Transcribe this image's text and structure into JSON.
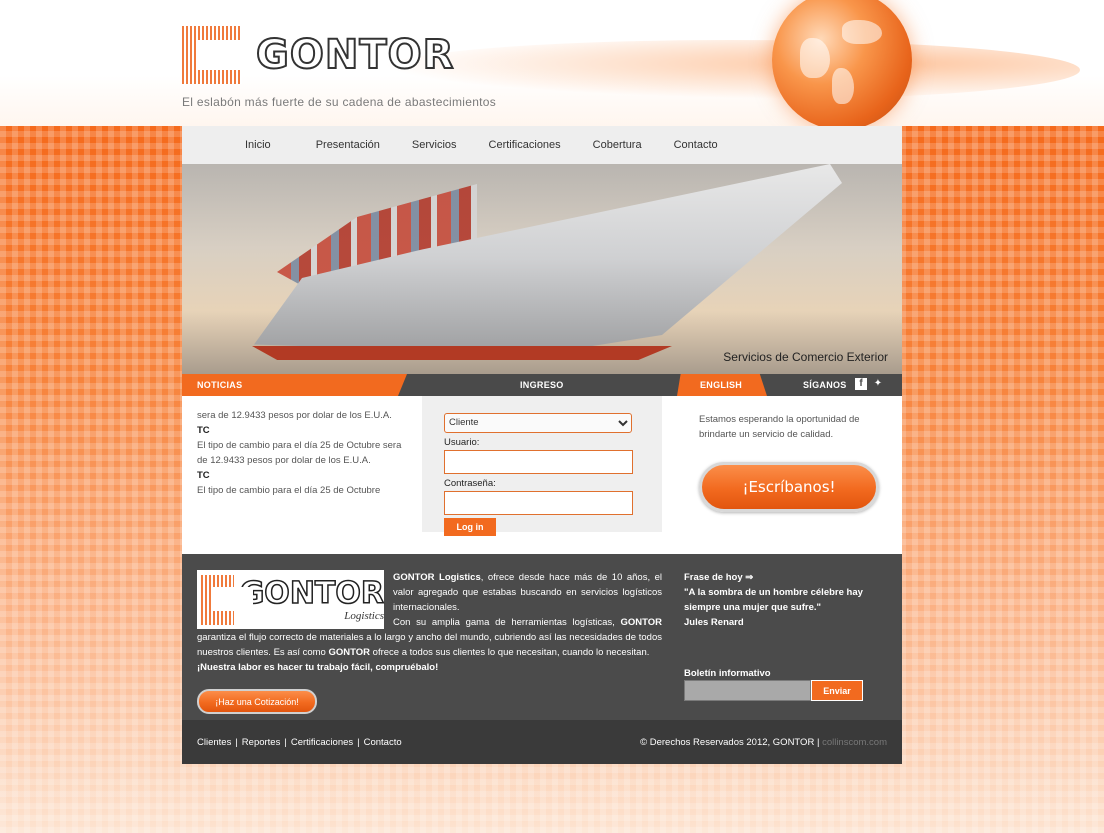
{
  "brand": {
    "name": "GONTOR",
    "tagline": "El eslabón más fuerte de su cadena de abastecimientos"
  },
  "nav": [
    "Inicio",
    "Presentación",
    "Servicios",
    "Certificaciones",
    "Cobertura",
    "Contacto"
  ],
  "hero": {
    "caption": "Servicios de Comercio Exterior"
  },
  "bar": {
    "news": "NOTICIAS",
    "login": "INGRESO",
    "language": "ENGLISH",
    "follow": "SÍGANOS"
  },
  "news": {
    "lines": [
      "sera de 12.9433 pesos por dolar de los E.U.A.",
      "TC",
      "El tipo de cambio para el día 25 de Octubre sera de 12.9433 pesos por dolar de los E.U.A.",
      "TC",
      "El tipo de cambio para el día 25 de Octubre"
    ]
  },
  "login": {
    "type_selected": "Cliente",
    "user_label": "Usuario:",
    "password_label": "Contraseña:",
    "button": "Log in"
  },
  "contact": {
    "text": "Estamos esperando la oportunidad de brindarte un servicio de calidad.",
    "button": "¡Escríbanos!"
  },
  "footer": {
    "logo_text": "GONTOR",
    "logo_sub": "Logistics",
    "about": {
      "p1_bold": "GONTOR Logistics",
      "p1": ", ofrece desde hace más de 10 años, el valor agregado que estabas buscando en servicios logísticos internacionales.",
      "p2a": "Con su amplia gama de herramientas logísticas, ",
      "p2_bold": "GONTOR",
      "p2b": " garantiza el flujo correcto de materiales a lo largo y ancho del mundo, cubriendo así las necesidades de todos nuestros clientes. Es así como ",
      "p2_bold2": "GONTOR",
      "p2c": " ofrece a todos sus clientes lo que necesitan, cuando lo necesitan.",
      "slogan": "¡Nuestra labor es hacer tu trabajo fácil, compruébalo!"
    },
    "quote_button": "¡Haz una Cotización!",
    "phrase_title": "Frase de hoy ⇒",
    "phrase": "\"A la sombra de un hombre célebre hay siempre una mujer que sufre.\"",
    "phrase_author": "Jules Renard",
    "newsletter_title": "Boletín informativo",
    "newsletter_button": "Enviar",
    "links": [
      "Clientes",
      "Reportes",
      "Certificaciones",
      "Contacto"
    ],
    "copyright": "© Derechos Reservados 2012, GONTOR",
    "credit": "collinscom.com"
  },
  "colors": {
    "accent": "#f26a1f",
    "dark": "#4b4b4b",
    "darker": "#3a3a3a"
  },
  "icons": {
    "facebook": "facebook-icon",
    "twitter": "twitter-icon"
  }
}
